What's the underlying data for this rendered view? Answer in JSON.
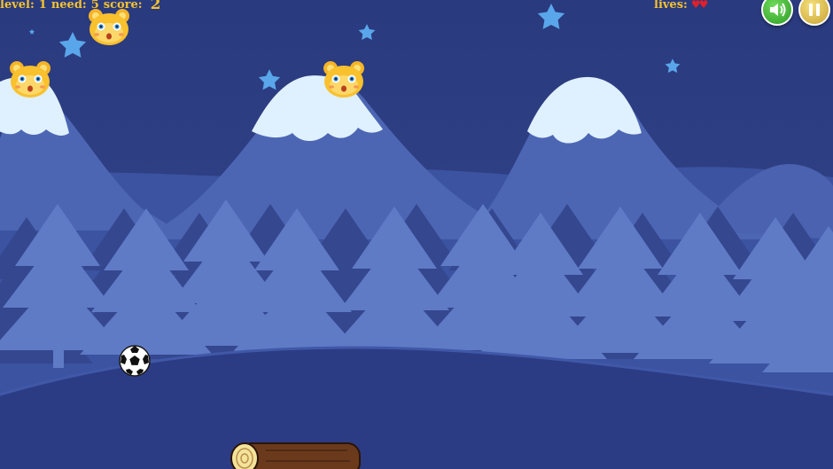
{
  "hud": {
    "level_label": "level:",
    "level_value": "1",
    "need_label": "need:",
    "need_value": "5",
    "score_label": "score:",
    "score_value": "2",
    "lives_label": "lives:",
    "lives_count": 2
  },
  "buttons": {
    "sound_icon": "speaker-icon",
    "pause_icon": "pause-icon"
  },
  "colors": {
    "sky": "#2c3c80",
    "hud_text": "#f3c231",
    "heart": "#e0202a",
    "sound_button": "#3eb52e",
    "pause_button": "#e3c04e"
  }
}
